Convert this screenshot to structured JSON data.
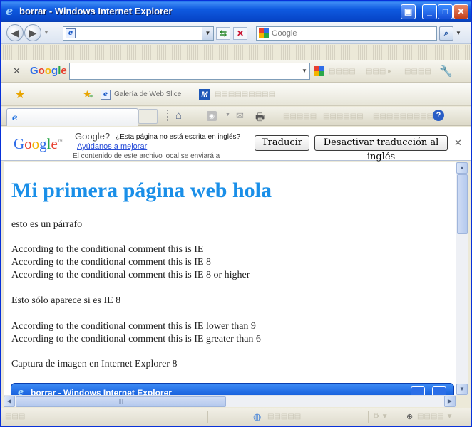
{
  "window": {
    "title": "borrar - Windows Internet Explorer"
  },
  "addressbar": {
    "url": "",
    "search_engine": "Google"
  },
  "google_toolbar": {
    "logo": "Google",
    "query": ""
  },
  "favorites": {
    "web_slice_gallery": "Galería de Web Slice"
  },
  "tabs": [
    {
      "label": ""
    }
  ],
  "translate_bar": {
    "logo": "Google",
    "question": "Google?",
    "question_detail": "¿Esta página no está escrita en inglés?",
    "help_link": "Ayúdanos a mejorar",
    "note": "El contenido de este archivo local se enviará a",
    "translate_button": "Traducir",
    "deactivate_button": "Desactivar traducción al inglés"
  },
  "page": {
    "heading": "Mi primera página web hola",
    "paragraphs": [
      "esto es un párrafo",
      "According to the conditional comment this is IE",
      "According to the conditional comment this is IE 8",
      "According to the conditional comment this is IE 8 or higher",
      "Esto sólo aparece si es IE 8",
      "According to the conditional comment this is IE lower than 9",
      "According to the conditional comment this is IE greater than 6",
      "Captura de imagen en Internet Explorer 8"
    ],
    "inner_window_title": "borrar - Windows Internet Explorer"
  },
  "colors": {
    "titlebar": "#0a5fe6",
    "heading": "#1a8fe8",
    "link": "#2a4fd8"
  }
}
